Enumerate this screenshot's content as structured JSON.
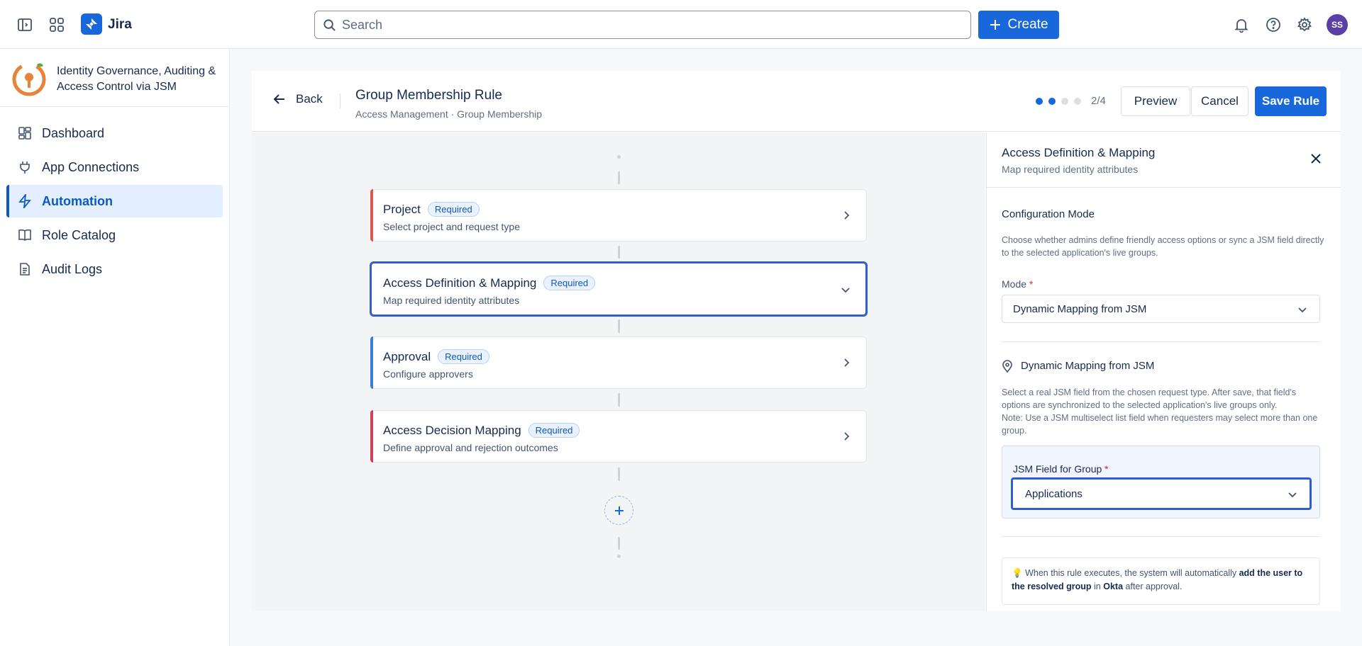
{
  "topbar": {
    "app_name": "Jira",
    "search_placeholder": "Search",
    "create_label": "Create",
    "avatar_initials": "SS",
    "brand_color": "#1868db"
  },
  "sidebar": {
    "app_title": "Identity Governance, Auditing & Access Control via JSM",
    "items": [
      {
        "label": "Dashboard",
        "icon": "dashboard-icon"
      },
      {
        "label": "App Connections",
        "icon": "plug-icon"
      },
      {
        "label": "Automation",
        "icon": "lightning-icon",
        "active": true
      },
      {
        "label": "Role Catalog",
        "icon": "book-icon"
      },
      {
        "label": "Audit Logs",
        "icon": "document-icon"
      }
    ]
  },
  "rule_header": {
    "back_label": "Back",
    "title": "Group Membership Rule",
    "subtitle": "Access Management · Group Membership",
    "step_indicator": "2/4",
    "current_step": 2,
    "total_steps": 4,
    "preview_label": "Preview",
    "cancel_label": "Cancel",
    "save_label": "Save Rule"
  },
  "steps": [
    {
      "title": "Project",
      "badge": "Required",
      "description": "Select project and request type",
      "accent": "#e0564a"
    },
    {
      "title": "Access Definition & Mapping",
      "badge": "Required",
      "description": "Map required identity attributes",
      "accent": "#2e5ec9",
      "selected": true
    },
    {
      "title": "Approval",
      "badge": "Required",
      "description": "Configure approvers",
      "accent": "#3d7be0"
    },
    {
      "title": "Access Decision Mapping",
      "badge": "Required",
      "description": "Define approval and rejection outcomes",
      "accent": "#d0405b"
    }
  ],
  "panel": {
    "title": "Access Definition & Mapping",
    "subtitle": "Map required identity attributes",
    "config_title": "Configuration Mode",
    "config_text": "Choose whether admins define friendly access options or sync a JSM field directly to the selected application's live groups.",
    "mode_label": "Mode",
    "mode_value": "Dynamic Mapping from JSM",
    "dynamic_title": "Dynamic Mapping from JSM",
    "dynamic_text": "Select a real JSM field from the chosen request type. After save, that field's options are synchronized to the selected application's live groups only.",
    "dynamic_note": "Note: Use a JSM multiselect list field when requesters may select more than one group.",
    "group_field_label": "JSM Field for Group",
    "group_field_value": "Applications",
    "note_prefix": "When this rule executes, the system will automatically",
    "note_bold": "add the user to the resolved group",
    "note_mid": "in",
    "note_app": "Okta",
    "note_suffix": "after approval."
  }
}
